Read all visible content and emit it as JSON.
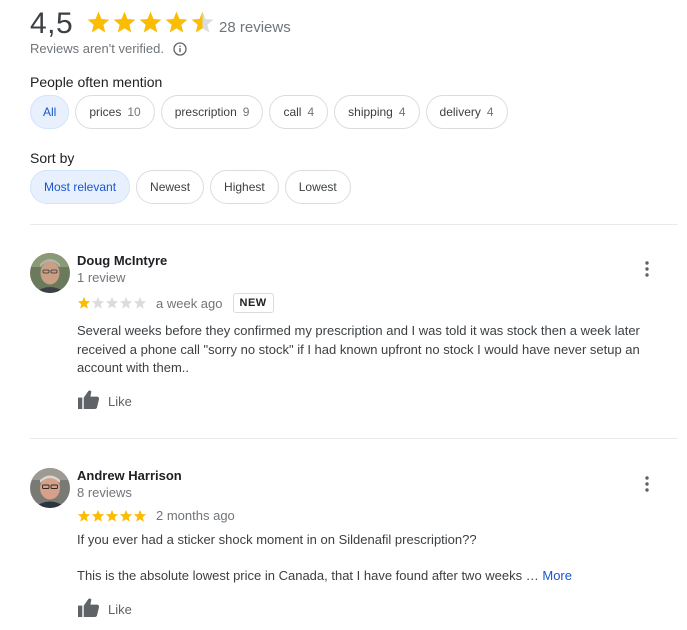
{
  "rating": {
    "value": "4,5",
    "stars": 4.5,
    "count_label": "28 reviews",
    "not_verified": "Reviews aren't verified.",
    "star_color": "#fbbc04"
  },
  "mentions": {
    "label": "People often mention",
    "chips": [
      {
        "label": "All",
        "count": "",
        "selected": true
      },
      {
        "label": "prices",
        "count": "10",
        "selected": false
      },
      {
        "label": "prescription",
        "count": "9",
        "selected": false
      },
      {
        "label": "call",
        "count": "4",
        "selected": false
      },
      {
        "label": "shipping",
        "count": "4",
        "selected": false
      },
      {
        "label": "delivery",
        "count": "4",
        "selected": false
      }
    ]
  },
  "sort": {
    "label": "Sort by",
    "options": [
      {
        "label": "Most relevant",
        "selected": true
      },
      {
        "label": "Newest",
        "selected": false
      },
      {
        "label": "Highest",
        "selected": false
      },
      {
        "label": "Lowest",
        "selected": false
      }
    ]
  },
  "reviews": [
    {
      "name": "Doug McIntyre",
      "sub": "1 review",
      "stars": 1,
      "time": "a week ago",
      "badge": "NEW",
      "text": "Several weeks before they confirmed my prescription and I was told it was stock then a week later received a phone call \"sorry no stock\" if I had known upfront no stock I would have never setup an account with them..",
      "like_label": "Like"
    },
    {
      "name": "Andrew Harrison",
      "sub": "8 reviews",
      "stars": 5,
      "time": "2 months ago",
      "text_line1": "If you ever had a sticker shock moment in on Sildenafil prescription??",
      "text_line2": "This is the absolute lowest price in Canada, that I have found after two weeks …",
      "more_label": "More",
      "like_label": "Like"
    }
  ]
}
